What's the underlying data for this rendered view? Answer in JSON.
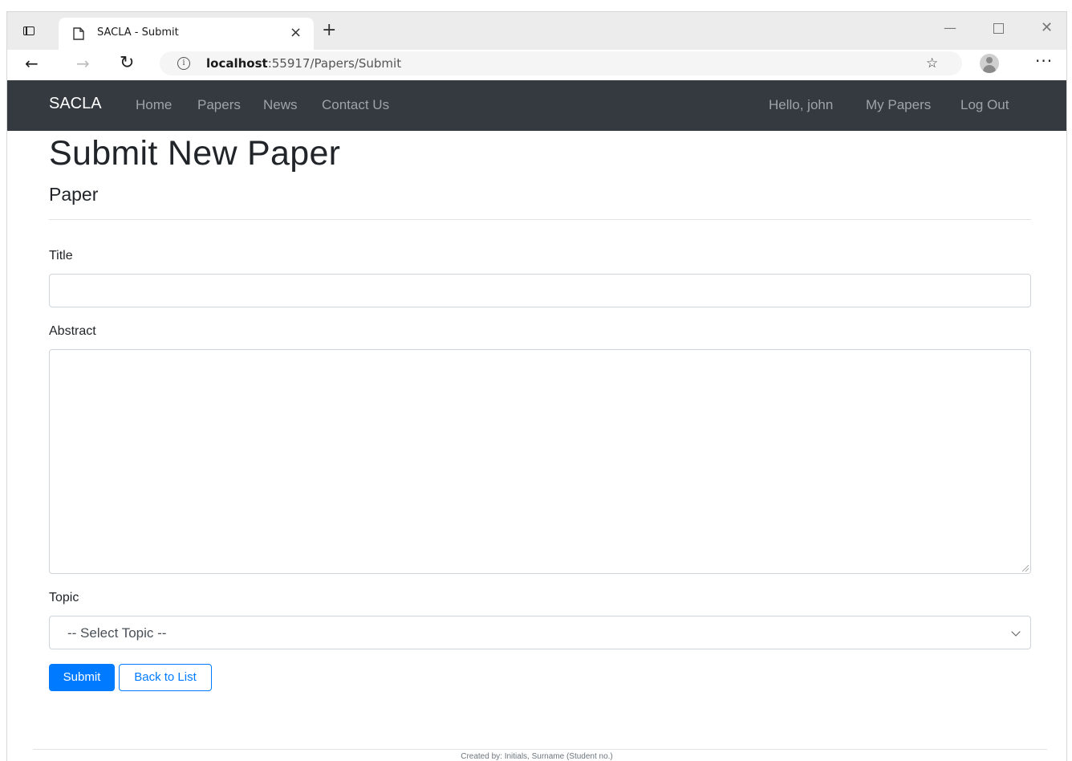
{
  "browser": {
    "tab_title": "SACLA - Submit",
    "tab_close": "×",
    "new_tab": "+",
    "url_host": "localhost",
    "url_rest": ":55917/Papers/Submit",
    "win_min": "—",
    "win_close": "✕",
    "back_icon": "←",
    "forward_icon": "→",
    "reload_icon": "↻",
    "info_icon": "i",
    "favorite_icon": "☆",
    "more_icon": "···"
  },
  "navbar": {
    "brand": "SACLA",
    "links": [
      "Home",
      "Papers",
      "News",
      "Contact Us"
    ],
    "greeting": "Hello, john",
    "my_papers": "My Papers",
    "logout": "Log Out",
    "background_color": "#343a40"
  },
  "page": {
    "title": "Submit New Paper",
    "subtitle": "Paper",
    "form": {
      "title_label": "Title",
      "title_value": "",
      "abstract_label": "Abstract",
      "abstract_value": "",
      "topic_label": "Topic",
      "topic_selected": "-- Select Topic --"
    },
    "buttons": {
      "submit": "Submit",
      "back": "Back to List"
    },
    "accent_color": "#007bff"
  },
  "footer": {
    "text": "Created by: Initials, Surname (Student no.)"
  }
}
